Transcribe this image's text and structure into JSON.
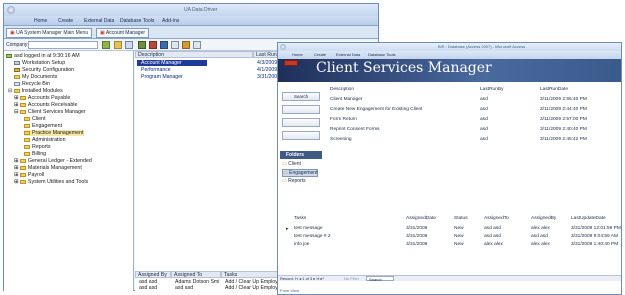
{
  "back": {
    "title": "UA Data Driver",
    "ribbon_tabs": [
      "Home",
      "Create",
      "External Data",
      "Database Tools",
      "Add-Ins"
    ],
    "doc_tabs": [
      "UA System Manager Main Menu",
      "Account Manager"
    ],
    "company_label": "Company",
    "tree": [
      "asd logged in at 9:30:16 AM",
      "Workstation Setup",
      "Security Configuration",
      "My Documents",
      "Recycle Bin",
      "Installed Modules",
      "Accounts Payable",
      "Accounts Receivable",
      "Client Services Manager",
      "Client",
      "Engagement",
      "Practice Management",
      "Administration",
      "Reports",
      "Billing",
      "General Ledger - Extended",
      "Materials Management",
      "Payroll",
      "System Utilities and Tools"
    ],
    "grid_headers": [
      "Description",
      "Last Run"
    ],
    "grid_rows": [
      {
        "desc": "Account Manager",
        "last": "4/3/2009 9:3"
      },
      {
        "desc": "Performance",
        "last": "4/1/2009 10:"
      },
      {
        "desc": "Program Manager",
        "last": "3/31/2009 4:"
      }
    ],
    "bottom_headers": [
      "Assigned By",
      "Assigned To",
      "Tasks"
    ],
    "bottom_rows": [
      [
        "asd asd",
        "Adams Dotson Smi",
        "Add / Clear Up Employees in"
      ],
      [
        "asd asd",
        "asd asd",
        "Add / Clear Up Employees in"
      ]
    ]
  },
  "front": {
    "title": "BIS : Database (Access 2007) - Microsoft Access",
    "ribbon_tabs": [
      "Home",
      "Create",
      "External Data",
      "Database Tools"
    ],
    "banner_title": "Client Services Manager",
    "search_label": "Search",
    "folders_header": "Folders",
    "folders": [
      "Client",
      "Engagement",
      "Reports"
    ],
    "report_headers": [
      "Description",
      "LastRunBy",
      "LastRunDate"
    ],
    "reports": [
      [
        "Client Manager",
        "asd",
        "3/11/2009 2:56:40 PM"
      ],
      [
        "Create New Engagement for Existing Client",
        "asd",
        "3/11/2009 2:44:40 PM"
      ],
      [
        "Form Return",
        "asd",
        "3/11/2009 2:57:00 PM"
      ],
      [
        "Reprint Consent Forms",
        "asd",
        "3/11/2009 2:40:40 PM"
      ],
      [
        "Screening",
        "asd",
        "3/11/2009 2:45:42 PM"
      ]
    ],
    "task_headers": [
      "Tasks",
      "AssignedDate",
      "Status",
      "AssignedTo",
      "AssignedBy",
      "LastUpdateDate"
    ],
    "tasks": [
      [
        "test message",
        "3/31/2009",
        "New",
        "asd asd",
        "alex alex",
        "3/31/2009 12:01:59 PM"
      ],
      [
        "test message # 2",
        "3/31/2009",
        "New",
        "asd asd",
        "asd asd",
        "3/31/2009 9:04:59 AM"
      ],
      [
        "info joe",
        "3/31/2009",
        "New",
        "alex alex",
        "alex alex",
        "3/31/2009 1:40:40 PM"
      ]
    ],
    "record_nav": "Record: H  ◂  1 of 3  ▸  H  ▸*",
    "filter_label": "No Filter",
    "search_box": "Search",
    "status": "Form View"
  }
}
